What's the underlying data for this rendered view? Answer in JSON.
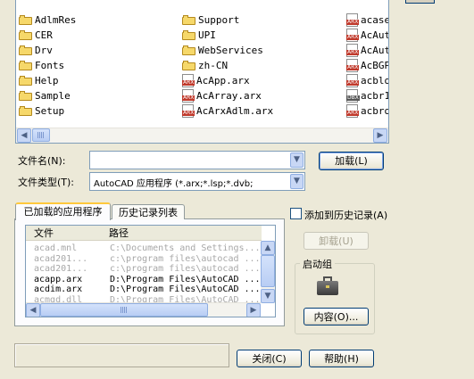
{
  "file_list": {
    "items": [
      {
        "name": "AdlmRes",
        "type": "folder"
      },
      {
        "name": "CER",
        "type": "folder"
      },
      {
        "name": "Drv",
        "type": "folder"
      },
      {
        "name": "Fonts",
        "type": "folder"
      },
      {
        "name": "Help",
        "type": "folder"
      },
      {
        "name": "Sample",
        "type": "folder"
      },
      {
        "name": "Setup",
        "type": "folder"
      },
      {
        "name": "Support",
        "type": "folder"
      },
      {
        "name": "UPI",
        "type": "folder"
      },
      {
        "name": "WebServices",
        "type": "folder"
      },
      {
        "name": "zh-CN",
        "type": "folder"
      },
      {
        "name": "AcApp.arx",
        "type": "arx"
      },
      {
        "name": "AcArray.arx",
        "type": "arx"
      },
      {
        "name": "AcArxAdlm.arx",
        "type": "arx"
      },
      {
        "name": "acase",
        "type": "arx"
      },
      {
        "name": "AcAut",
        "type": "arx"
      },
      {
        "name": "AcAut",
        "type": "arx"
      },
      {
        "name": "AcBGP",
        "type": "arx"
      },
      {
        "name": "acblo",
        "type": "arx"
      },
      {
        "name": "acbr1",
        "type": "dbx"
      },
      {
        "name": "acbro",
        "type": "arx"
      }
    ],
    "badge_arx": "ARX",
    "badge_dbx": "DBX"
  },
  "filename": {
    "label": "文件名(N):",
    "value": ""
  },
  "filetype": {
    "label": "文件类型(T):",
    "value": "AutoCAD 应用程序 (*.arx;*.lsp;*.dvb;"
  },
  "buttons": {
    "load": "加载(L)",
    "unload": "卸载(U)",
    "contents": "内容(O)...",
    "close": "关闭(C)",
    "help": "帮助(H)"
  },
  "tabs": [
    "已加载的应用程序",
    "历史记录列表"
  ],
  "add_history": "添加到历史记录(A)",
  "startup_group": "启动组",
  "loaded_apps": {
    "columns": [
      "文件",
      "路径"
    ],
    "rows": [
      {
        "file": "acad.mnl",
        "path": "C:\\Documents and Settings...",
        "dim": true
      },
      {
        "file": "acad201...",
        "path": "c:\\program files\\autocad ...",
        "dim": true
      },
      {
        "file": "acad201...",
        "path": "c:\\program files\\autocad ...",
        "dim": true
      },
      {
        "file": "acapp.arx",
        "path": "D:\\Program Files\\AutoCAD ...",
        "dim": false
      },
      {
        "file": "acdim.arx",
        "path": "D:\\Program Files\\AutoCAD ...",
        "dim": false
      },
      {
        "file": "acmgd.dll",
        "path": "D:\\Program Files\\AutoCAD ...",
        "dim": true
      }
    ]
  },
  "status_text": ""
}
